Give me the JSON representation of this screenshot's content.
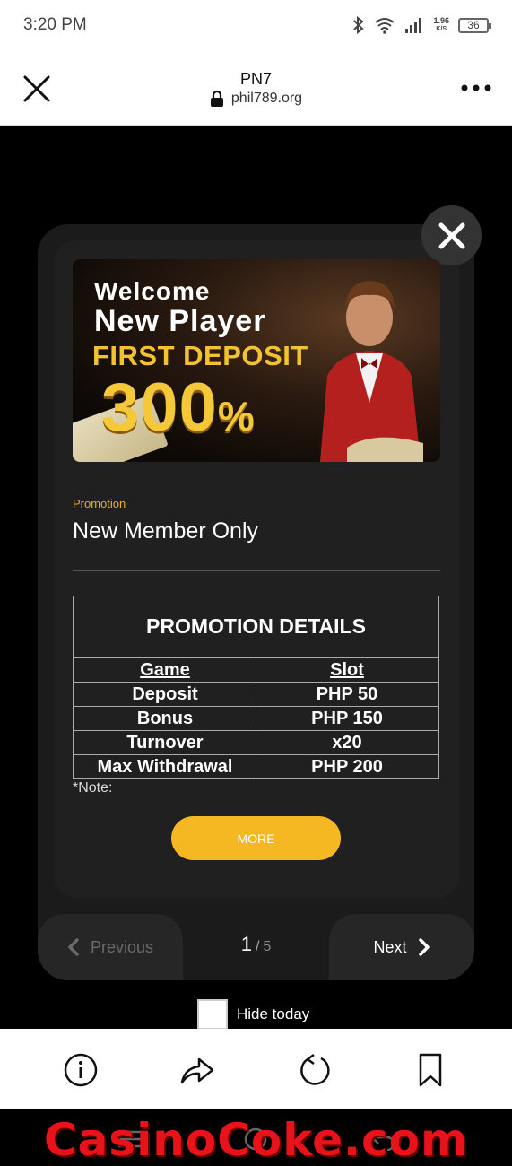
{
  "status_bar": {
    "time": "3:20 PM",
    "net_speed_value": "1.96",
    "net_speed_unit": "K/S",
    "battery": "36"
  },
  "url_bar": {
    "title": "PN7",
    "domain": "phil789.org"
  },
  "banner": {
    "line1": "Welcome",
    "line2": "New Player",
    "line3": "FIRST DEPOSIT",
    "line4": "300",
    "line4_suffix": "%"
  },
  "promotion": {
    "label": "Promotion",
    "title": "New Member Only",
    "details_title": "PROMOTION DETAILS",
    "table": [
      [
        "Game",
        "Slot"
      ],
      [
        "Deposit",
        "PHP 50"
      ],
      [
        "Bonus",
        "PHP 150"
      ],
      [
        "Turnover",
        "x20"
      ],
      [
        "Max Withdrawal",
        "PHP 200"
      ]
    ],
    "note": "*Note:",
    "more_label": "MORE"
  },
  "pager": {
    "prev_label": "Previous",
    "next_label": "Next",
    "current": "1",
    "separator": "/",
    "total": "5"
  },
  "hide_today_label": "Hide today",
  "watermark": "CasinoCoke.com",
  "colors": {
    "accent": "#f5b823",
    "modal_bg": "#1b1b1b",
    "watermark": "#e8121a"
  }
}
